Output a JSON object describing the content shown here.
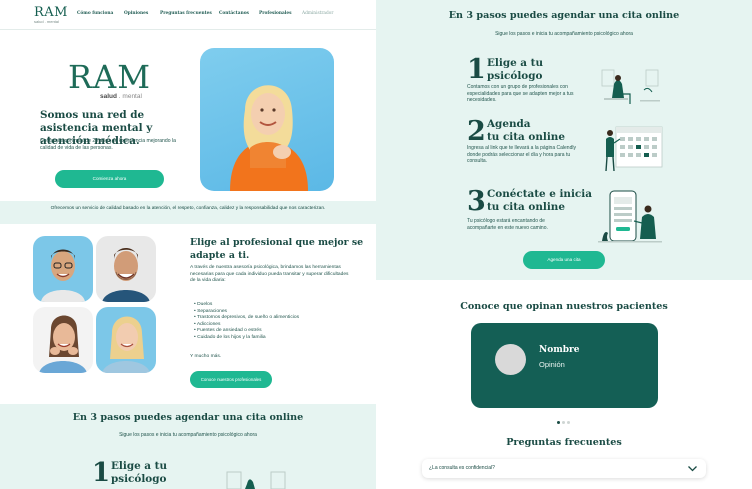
{
  "nav": {
    "logo": "RAM",
    "logo_sub": "salud . mental",
    "items": [
      "Cómo funciona",
      "Opiniones",
      "Preguntas frecuentes",
      "Contáctanos",
      "Profesionales",
      "Administrador"
    ]
  },
  "hero": {
    "logo": "RAM",
    "logo_sub_a": "salud",
    "logo_sub_b": ". mental",
    "title": "Somos una red de asistencia mental y atención médica.",
    "text": "Contamos con más de 25 años de experiencia mejorando la calidad de vida de las personas.",
    "button": "Comienza ahora"
  },
  "band": {
    "text": "Ofrecemos un servicio de calidad basado en la atención, el respeto, confianza, calidez y la responsabilidad que nos caracterizan."
  },
  "professional": {
    "title": "Elige al profesional que mejor se adapte a ti.",
    "text": "A través de nuestra asesoría psicológica, brindamos las herramientas necesarias para que cada individuo pueda transitar y superar dificultades de la vida diaria:",
    "list": [
      "Duelos",
      "Separaciones",
      "Trastornos depresivos, de sueño o alimenticios",
      "Adicciones",
      "Fuentes de ansiedad o estrés",
      "Cuidado de los hijos y la familia"
    ],
    "more": "Y mucho más.",
    "button": "Conoce nuestros profesionales"
  },
  "steps": {
    "title": "En 3 pasos puedes agendar una cita online",
    "subtitle": "Sigue los pasos e inicia tu acompañamiento psicológico ahora",
    "items": [
      {
        "num": "1",
        "title_a": "Elige a tu",
        "title_b": "psicólogo",
        "text": "Contamos con un grupo de profesionales con especialidades para que se adapten mejor a tus necesidades."
      },
      {
        "num": "2",
        "title_a": "Agenda",
        "title_b": "tu cita online",
        "text": "Ingresa al link que te llevará a la página Calendly donde podrás seleccionar el día y hora para tu consulta."
      },
      {
        "num": "3",
        "title_a": "Conéctate e inicia",
        "title_b": "tu cita online",
        "text": "Tu psicólogo estará encantando de acompañarte en este nuevo camino."
      }
    ],
    "button": "Agenda una cita"
  },
  "opinions": {
    "title": "Conoce que opinan nuestros pacientes",
    "card_name": "Nombre",
    "card_opinion": "Opinión"
  },
  "faq": {
    "title": "Preguntas frecuentes",
    "question": "¿La consulta es confidencial?"
  },
  "colors": {
    "accent": "#1fb892",
    "dark": "#145f55",
    "text": "#1a4b44",
    "band": "#e6f4f1"
  }
}
